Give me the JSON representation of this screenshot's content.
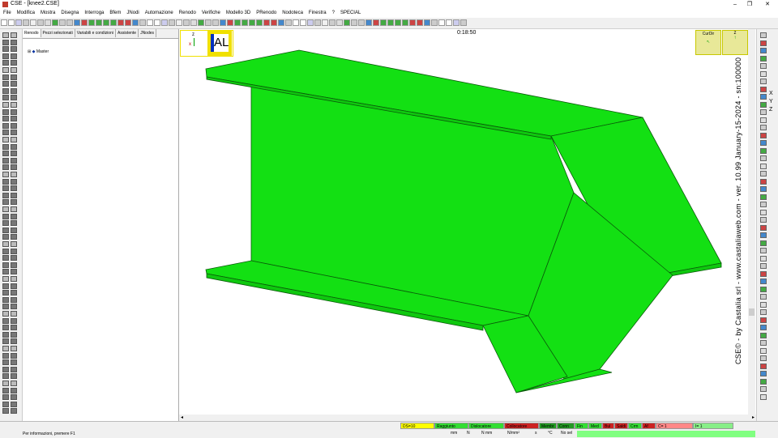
{
  "window": {
    "title": "CSE - [knee2.CSE]",
    "controls": [
      "–",
      "❐",
      "✕"
    ]
  },
  "menu": [
    "File",
    "Modifica",
    "Mostra",
    "Disegna",
    "Interroga",
    "Bfem",
    "JNodi",
    "Automazione",
    "Renodo",
    "Verifiche",
    "Modello 3D",
    "PRenodo",
    "Nodoteca",
    "Finestra",
    "?",
    "SPECIAL"
  ],
  "tree": {
    "tabs": [
      "Renodo",
      "Pezzi selezionati",
      "Variabili e condizioni",
      "Assistente",
      "JNodes"
    ],
    "root_expander": "⊞",
    "root_label": "Master"
  },
  "viewport": {
    "time": "0:18:50",
    "al_label": "AL",
    "ucs_axis_z": "z",
    "ucs_axis_x": "x",
    "cudir_label": "CurDir",
    "cudir_z": "z",
    "version_text": "CSE© - by Castalia srl - www.castaliaweb.com - ver. 10.99 January-15-2024 - sn:100000",
    "model_color": "#13e013",
    "edge_color": "#0a5a0a"
  },
  "right_axes": [
    "X",
    "Y",
    "Z"
  ],
  "status": {
    "message": "Per informazioni, premere F1",
    "indicators": [
      {
        "label": "DS=10",
        "bg": "#ffff00"
      },
      {
        "label": "Raggiunto",
        "bg": "#33dd33"
      },
      {
        "label": "Dislocatore",
        "bg": "#33dd33"
      },
      {
        "label": "Collocatore",
        "bg": "#cc2222"
      },
      {
        "label": "Membr",
        "bg": "#229922"
      },
      {
        "label": "Conn",
        "bg": "#229922"
      },
      {
        "label": "Fin",
        "bg": "#33dd33"
      },
      {
        "label": "Med",
        "bg": "#33dd33"
      },
      {
        "label": "Bul",
        "bg": "#cc2222"
      },
      {
        "label": "Saldi",
        "bg": "#cc2222"
      },
      {
        "label": "Crm",
        "bg": "#33dd33"
      },
      {
        "label": "Af",
        "bg": "#cc2222"
      },
      {
        "label": "C= 1",
        "bg": "#ff8888"
      },
      {
        "label": "I= 1",
        "bg": "#88ee88"
      }
    ],
    "units": [
      "mm",
      "N",
      "N mm",
      "N/mm²",
      "s",
      "°C",
      "No sel"
    ]
  }
}
